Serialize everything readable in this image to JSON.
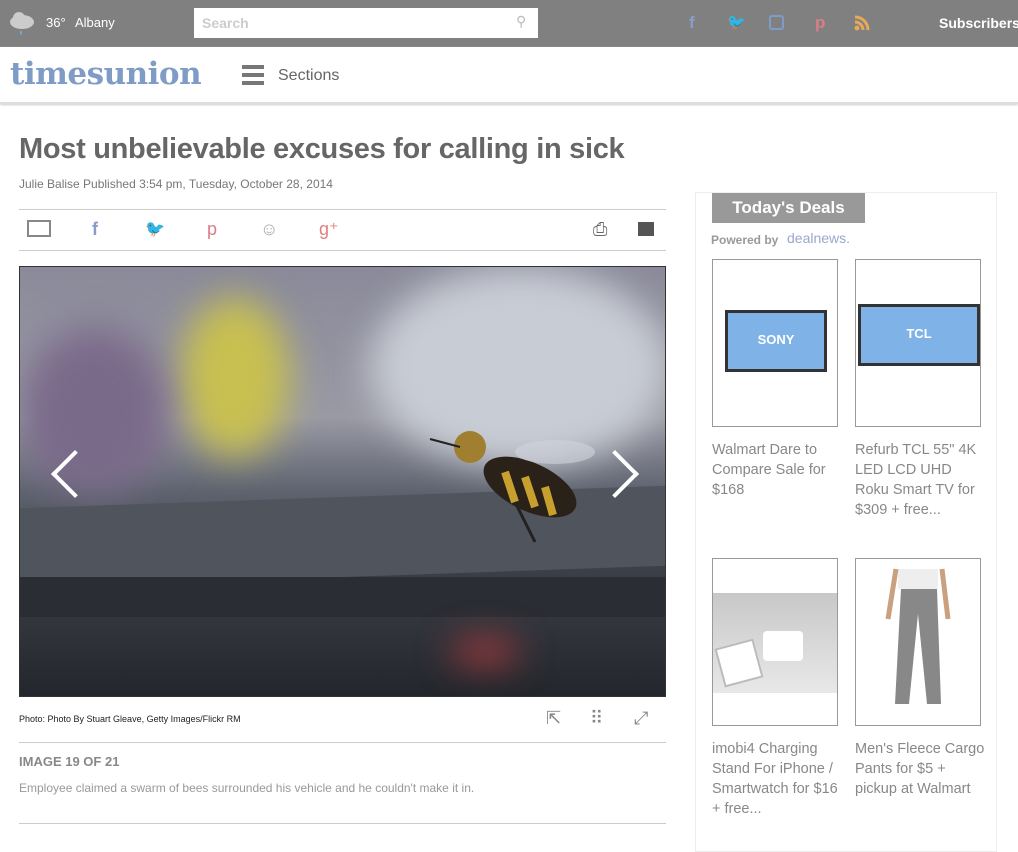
{
  "topbar": {
    "temp": "36°",
    "city": "Albany",
    "search_placeholder": "Search",
    "subscribers": "Subscribers",
    "social": [
      {
        "icon": "facebook-icon",
        "glyph": "f",
        "color": "#8a9cc8"
      },
      {
        "icon": "twitter-icon",
        "glyph": "🐦",
        "color": "#7fb4e0"
      },
      {
        "icon": "instagram-icon",
        "glyph": "◙",
        "color": "#7f9cc6"
      },
      {
        "icon": "pinterest-icon",
        "glyph": "𝓅",
        "color": "#d87f86"
      },
      {
        "icon": "rss-icon",
        "glyph": "◔",
        "color": "#e8a85a"
      }
    ]
  },
  "header": {
    "logo": "timesunion",
    "sections": "Sections"
  },
  "article": {
    "title": "Most unbelievable excuses for calling in sick",
    "byline": "Julie Balise  Published 3:54 pm, Tuesday, October 28, 2014",
    "photo_credit": "Photo: Photo By Stuart Gleave, Getty Images/Flickr RM",
    "counter": "IMAGE 19 OF 21",
    "description": "Employee claimed a swarm of bees surrounded his vehicle and he couldn't make it in."
  },
  "sidebar": {
    "title": "Today's Deals",
    "powered_by": "Powered by",
    "dealnews": "dealnews.",
    "deals": [
      {
        "label": "Walmart Dare to Compare Sale for $168",
        "brand": "SONY"
      },
      {
        "label": "Refurb TCL 55\" 4K LED LCD UHD Roku Smart TV for $309 + free...",
        "brand": "TCL"
      },
      {
        "label": "imobi4 Charging Stand For iPhone / Smartwatch for $16 + free..."
      },
      {
        "label": "Men's Fleece Cargo Pants for $5 + pickup at Walmart"
      }
    ]
  }
}
